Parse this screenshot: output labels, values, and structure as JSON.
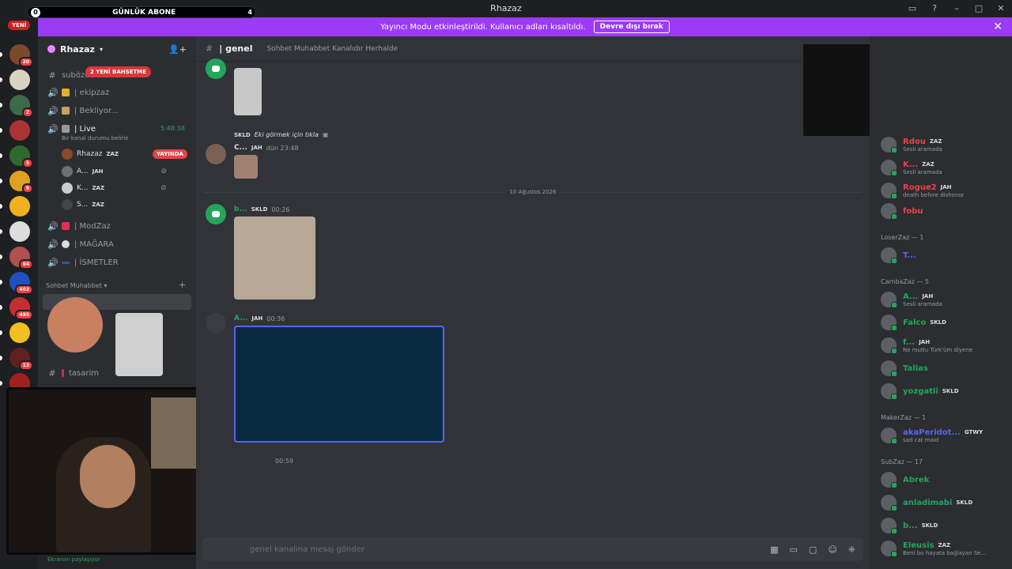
{
  "window": {
    "title": "Rhazaz"
  },
  "overlay": {
    "goal_label": "GÜNLÜK ABONE",
    "goal_current": "0",
    "goal_target": "4",
    "new_badge": "YENİ"
  },
  "notice": {
    "text": "Yayıncı Modu etkinleştirildi. Kullanıcı adları kısaltıldı.",
    "button": "Devre dışı bırak",
    "close": "✕"
  },
  "servers": [
    {
      "badge": "20",
      "color": "#7a4a2a"
    },
    {
      "badge": "",
      "color": "#d9d3c0"
    },
    {
      "badge": "2",
      "color": "#3b6b48"
    },
    {
      "badge": "",
      "color": "#a33"
    },
    {
      "badge": "5",
      "color": "#2c6b2c"
    },
    {
      "badge": "9",
      "color": "#e0a020"
    },
    {
      "badge": "",
      "color": "#f0b020"
    },
    {
      "badge": "",
      "color": "#ddd"
    },
    {
      "badge": "64",
      "color": "#b05050"
    },
    {
      "badge": "402",
      "color": "#2050c0"
    },
    {
      "badge": "495",
      "color": "#c03030"
    },
    {
      "badge": "",
      "color": "#f0c020"
    },
    {
      "badge": "13",
      "color": "#602020"
    },
    {
      "badge": "",
      "color": "#a02020"
    }
  ],
  "sidebar": {
    "server_name": "Rhazaz",
    "mention_pill": "2 YENİ BAHSETME",
    "channels": [
      {
        "sym": "#",
        "label": "suböze"
      },
      {
        "sym": "🔊",
        "label": "| ekipzaz"
      },
      {
        "sym": "🔊",
        "label": "| Bekliyor..."
      },
      {
        "sym": "🔊",
        "label": "| Live"
      }
    ],
    "live_time": "5:48:38",
    "live_status": "Bir kanal durumu belirle",
    "voice_members": [
      {
        "name": "Rhazaz",
        "tag": "ZAZ",
        "live": "YAYINDA"
      },
      {
        "name": "A...",
        "tag": "JAH"
      },
      {
        "name": "K...",
        "tag": "ZAZ"
      },
      {
        "name": "S...",
        "tag": "ZAZ"
      }
    ],
    "voice_channels2": [
      {
        "label": "| ModZaz"
      },
      {
        "label": "| MAĞARA"
      },
      {
        "label": "| İSMETLER"
      }
    ],
    "category": "Sohbet Muhabbet",
    "text_channels": [
      {
        "label": "tasarim"
      }
    ],
    "user_status": "Ekranını paylaşıyor"
  },
  "chat": {
    "channel": "| genel",
    "topic": "Sohbet Muhabbet Kanalıdır Herhalde",
    "reply_user_tag": "SKLD",
    "reply_text": "Eki görmek için tıkla",
    "messages": [
      {
        "user": "C...",
        "tag": "JAH",
        "time": "dün 23:48"
      },
      {
        "user": "b...",
        "tag": "SKLD",
        "time": "00:26"
      },
      {
        "user": "A...",
        "tag": "JAH",
        "time": "00:36"
      },
      {
        "user": "",
        "tag": "",
        "time": "00:59"
      }
    ],
    "date_divider": "10 Ağustos 2026",
    "composer_placeholder": "genel kanalına mesaj gönder"
  },
  "members": {
    "groups": [
      {
        "title": "LoserZaz — 1"
      },
      {
        "title": "CambaZaz — 5"
      },
      {
        "title": "MakerZaz — 1"
      },
      {
        "title": "SubZaz — 17"
      }
    ],
    "list": [
      {
        "name": "Rdou",
        "tag": "ZAZ",
        "status": "Sesli aramada",
        "color": "#ed4245"
      },
      {
        "name": "K...",
        "tag": "ZAZ",
        "status": "Sesli aramada",
        "color": "#ed4245"
      },
      {
        "name": "Rogue2",
        "tag": "JAH",
        "status": "death before dishonor",
        "color": "#ed4245"
      },
      {
        "name": "fobu",
        "tag": "",
        "status": "",
        "color": "#ed4245"
      },
      {
        "name": "T...",
        "tag": "",
        "status": "",
        "color": "#5865f2"
      },
      {
        "name": "A...",
        "tag": "JAH",
        "status": "Sesli aramada",
        "color": "#23a55a"
      },
      {
        "name": "Falco",
        "tag": "SKLD",
        "status": "",
        "color": "#23a55a"
      },
      {
        "name": "f...",
        "tag": "JAH",
        "status": "Ne mutlu Türk'üm diyene",
        "color": "#23a55a"
      },
      {
        "name": "Talias",
        "tag": "",
        "status": "",
        "color": "#23a55a"
      },
      {
        "name": "yozgatli",
        "tag": "SKLD",
        "status": "",
        "color": "#23a55a"
      },
      {
        "name": "akaPeridot...",
        "tag": "GTWY",
        "status": "sad cat maid",
        "color": "#5865f2"
      },
      {
        "name": "Abrek",
        "tag": "",
        "status": "",
        "color": "#23a55a"
      },
      {
        "name": "anladimabi",
        "tag": "SKLD",
        "status": "",
        "color": "#23a55a"
      },
      {
        "name": "b...",
        "tag": "SKLD",
        "status": "",
        "color": "#23a55a"
      },
      {
        "name": "Eleusis",
        "tag": "ZAZ",
        "status": "Beni bu hayata bağlayan Se...",
        "color": "#23a55a"
      }
    ]
  }
}
